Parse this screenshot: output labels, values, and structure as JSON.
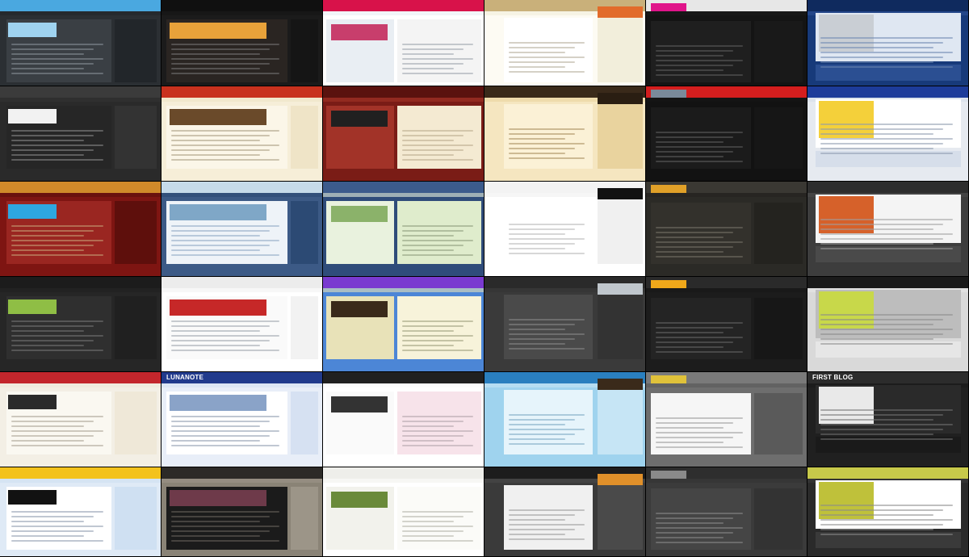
{
  "page": {
    "background": "#111111"
  },
  "visible_labels": {
    "tile_26_brand": "LUNANOTE",
    "tile_30_brand": "FIRST BLOG"
  },
  "tiles": [
    {
      "bg": "#2b2f33",
      "hdr": "#4aa8e0",
      "content": "#3a3f44",
      "side": "#22262a",
      "img": "#9fd3f0",
      "text": "#8a939b"
    },
    {
      "bg": "#1b1b1b",
      "hdr": "#101010",
      "content": "#2a2522",
      "side": "#151515",
      "img": "#e8a23a",
      "text": "#777777"
    },
    {
      "bg": "#ffffff",
      "hdr": "#d8124a",
      "content": "#f4f4f4",
      "side": "#e9eef3",
      "img": "#c83e6c",
      "text": "#9aa3ab"
    },
    {
      "bg": "#fdfbf3",
      "hdr": "#c9b07a",
      "content": "#ffffff",
      "side": "#f2eedb",
      "img": "#e26b2a",
      "text": "#b3ab98"
    },
    {
      "bg": "#141414",
      "hdr": "#e7e7e7",
      "content": "#1f1f1f",
      "side": "#191919",
      "img": "#e0148a",
      "text": "#5e5e5e"
    },
    {
      "bg": "#173a7a",
      "hdr": "#0f2a5e",
      "content": "#dfe7f2",
      "side": "#2b4f92",
      "img": "#c9ced4",
      "text": "#6b86b0"
    },
    {
      "bg": "#2a2a2a",
      "hdr": "#3b3b3b",
      "content": "#262626",
      "side": "#333333",
      "img": "#f2f2f2",
      "text": "#8c8c8c"
    },
    {
      "bg": "#f6eed8",
      "hdr": "#c8321e",
      "content": "#fbf6e8",
      "side": "#efe4c7",
      "img": "#6a4a2a",
      "text": "#a89b7e"
    },
    {
      "bg": "#7a1c16",
      "hdr": "#5a120e",
      "content": "#f4ead2",
      "side": "#a23328",
      "img": "#202020",
      "text": "#b8a88a"
    },
    {
      "bg": "#f5e6c0",
      "hdr": "#3a2a1a",
      "content": "#fbf1d6",
      "side": "#e9d39e",
      "img": "#2a1e12",
      "text": "#a88c5c"
    },
    {
      "bg": "#121212",
      "hdr": "#d41e1e",
      "content": "#1b1b1b",
      "side": "#161616",
      "img": "#7a8a9a",
      "text": "#5f5f5f"
    },
    {
      "bg": "#e6eaf0",
      "hdr": "#1d3c9a",
      "content": "#ffffff",
      "side": "#d6deea",
      "img": "#f4d03a",
      "text": "#8c99ad"
    },
    {
      "bg": "#7e1512",
      "hdr": "#d08a2a",
      "content": "#9a2621",
      "side": "#5e0f0c",
      "img": "#2ea7e0",
      "text": "#c9a47a"
    },
    {
      "bg": "#3c5a86",
      "hdr": "#c6dbea",
      "content": "#eef3f8",
      "side": "#2c4a74",
      "img": "#7fa7c7",
      "text": "#8ea6c2"
    },
    {
      "bg": "#2f4c7a",
      "hdr": "#3c5b8c",
      "content": "#dfeccc",
      "side": "#e9f2de",
      "img": "#8bb26a",
      "text": "#8a9a7a"
    },
    {
      "bg": "#ffffff",
      "hdr": "#f3f3f3",
      "content": "#ffffff",
      "side": "#f0f0f0",
      "img": "#111111",
      "text": "#b6b6b6"
    },
    {
      "bg": "#2b2a26",
      "hdr": "#3a3833",
      "content": "#33312c",
      "side": "#24231f",
      "img": "#e0a028",
      "text": "#77736a"
    },
    {
      "bg": "#3d3d3d",
      "hdr": "#2d2d2d",
      "content": "#f4f4f4",
      "side": "#4a4a4a",
      "img": "#d6612a",
      "text": "#a0a0a0"
    },
    {
      "bg": "#262626",
      "hdr": "#1c1c1c",
      "content": "#2f2f2f",
      "side": "#202020",
      "img": "#8fbe45",
      "text": "#777777"
    },
    {
      "bg": "#ffffff",
      "hdr": "#ececec",
      "content": "#fafafa",
      "side": "#f2f2f2",
      "img": "#c62828",
      "text": "#9aa3ab"
    },
    {
      "bg": "#4c86d6",
      "hdr": "#7a3ad0",
      "content": "#f7f3da",
      "side": "#e8e2b8",
      "img": "#3a2a1a",
      "text": "#9a9a7a"
    },
    {
      "bg": "#3a3a3a",
      "hdr": "#2a2a2a",
      "content": "#4a4a4a",
      "side": "#333333",
      "img": "#bfc6cc",
      "text": "#8a8a8a"
    },
    {
      "bg": "#1c1c1c",
      "hdr": "#2a2a2a",
      "content": "#242424",
      "side": "#171717",
      "img": "#f0a81a",
      "text": "#666666"
    },
    {
      "bg": "#d9d9d9",
      "hdr": "#1a1a1a",
      "content": "#bdbdbd",
      "side": "#e6e6e6",
      "img": "#c8d84a",
      "text": "#8a8a8a"
    },
    {
      "bg": "#f3efe5",
      "hdr": "#c3262c",
      "content": "#faf8f1",
      "side": "#efe8d8",
      "img": "#2a2a2a",
      "text": "#a7a092"
    },
    {
      "bg": "#e8eef8",
      "hdr": "#213a8c",
      "content": "#ffffff",
      "side": "#d6e1f2",
      "img": "#8aa3c8",
      "text": "#8c99ad"
    },
    {
      "bg": "#ffffff",
      "hdr": "#202020",
      "content": "#f7e3ea",
      "side": "#fafafa",
      "img": "#333333",
      "text": "#b0a2a8"
    },
    {
      "bg": "#9fd3ee",
      "hdr": "#2a7fbf",
      "content": "#e6f4fb",
      "side": "#c6e5f5",
      "img": "#3a2a1a",
      "text": "#7aa8c2"
    },
    {
      "bg": "#6e6e6e",
      "hdr": "#7a7a7a",
      "content": "#f6f6f6",
      "side": "#5a5a5a",
      "img": "#e0c23a",
      "text": "#9a9a9a"
    },
    {
      "bg": "#202020",
      "hdr": "#2c2c2c",
      "content": "#2a2a2a",
      "side": "#1a1a1a",
      "img": "#e9e9e9",
      "text": "#727272"
    },
    {
      "bg": "#dfeaf6",
      "hdr": "#f3c21c",
      "content": "#ffffff",
      "side": "#cfe0f2",
      "img": "#121212",
      "text": "#8c99ad"
    },
    {
      "bg": "#8a8376",
      "hdr": "#2c2a27",
      "content": "#1b1b1b",
      "side": "#9c9588",
      "img": "#6e3a4a",
      "text": "#6a655c"
    },
    {
      "bg": "#ffffff",
      "hdr": "#eeeeea",
      "content": "#fbfbf8",
      "side": "#f2f2ec",
      "img": "#6a8a3a",
      "text": "#b3b3a8"
    },
    {
      "bg": "#3a3a3a",
      "hdr": "#1d1d1d",
      "content": "#f0f0f0",
      "side": "#4a4a4a",
      "img": "#e0902a",
      "text": "#9a9a9a"
    },
    {
      "bg": "#3b3b3b",
      "hdr": "#2e2e2e",
      "content": "#454545",
      "side": "#333333",
      "img": "#8a8a8a",
      "text": "#8a8a8a"
    },
    {
      "bg": "#2a2a2a",
      "hdr": "#c7c94a",
      "content": "#ffffff",
      "side": "#3a3a3a",
      "img": "#bfc13a",
      "text": "#8a8a8a"
    }
  ]
}
